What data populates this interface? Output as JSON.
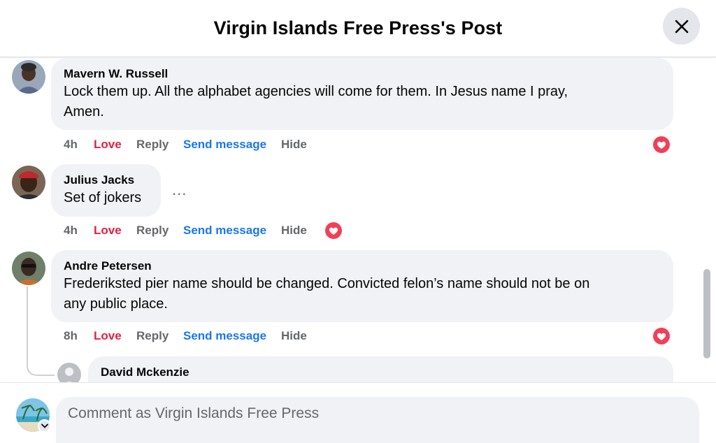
{
  "header": {
    "title": "Virgin Islands Free Press's Post"
  },
  "actions_labels": {
    "love": "Love",
    "reply": "Reply",
    "send": "Send message",
    "hide": "Hide"
  },
  "comments": [
    {
      "author": "Mavern W. Russell",
      "text_line1": "Lock them up. All the alphabet agencies will come for them. In Jesus name I pray,",
      "text_line2": "Amen.",
      "time": "4h",
      "reaction": "love"
    },
    {
      "author": "Julius Jacks",
      "text_line1": "Set of jokers",
      "time": "4h",
      "more": "...",
      "reaction": "love"
    },
    {
      "author": "Andre Petersen",
      "text_line1": "Frederiksted pier name should be changed. Convicted felon’s name should not be on",
      "text_line2": "any public place.",
      "time": "8h",
      "reaction": "love"
    },
    {
      "author": "David Mckenzie"
    }
  ],
  "composer": {
    "placeholder": "Comment as Virgin Islands Free Press"
  },
  "colors": {
    "love": "#e41e3f",
    "link": "#1877f2",
    "bubble": "#f0f2f5",
    "muted": "#65676b"
  }
}
